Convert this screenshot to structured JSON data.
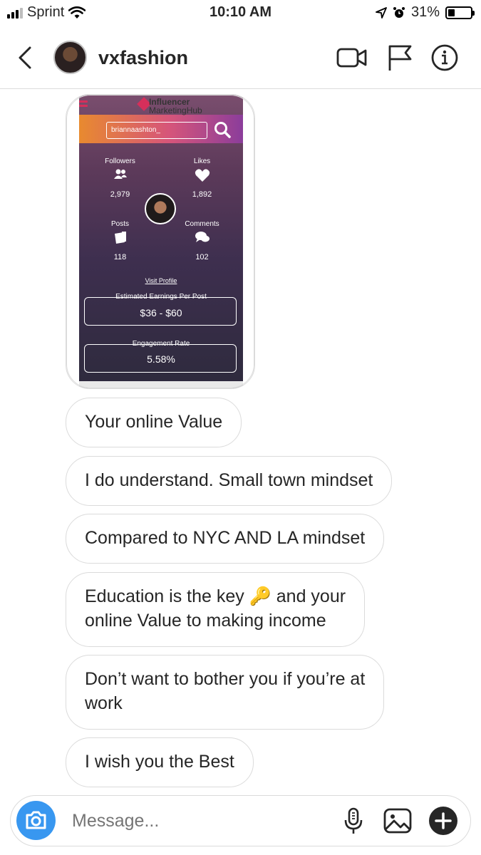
{
  "status_bar": {
    "carrier": "Sprint",
    "time": "10:10 AM",
    "battery_percent": "31%",
    "battery_level": 0.31,
    "signal_bars": 3
  },
  "header": {
    "username": "vxfashion",
    "icons": [
      "back-arrow-icon",
      "video-call-icon",
      "flag-icon",
      "info-icon"
    ]
  },
  "shared_post": {
    "brand_line1": "Influencer",
    "brand_line2": "MarketingHub",
    "search_value": "briannaashton_",
    "stats": [
      {
        "label": "Followers",
        "value": "2,979"
      },
      {
        "label": "Likes",
        "value": "1,892"
      },
      {
        "label": "Posts",
        "value": "118"
      },
      {
        "label": "Comments",
        "value": "102"
      }
    ],
    "visit_profile": "Visit Profile",
    "earnings_label": "Estimated Earnings Per Post",
    "earnings_value": "$36 - $60",
    "engagement_label": "Engagement Rate",
    "engagement_value": "5.58%"
  },
  "messages": [
    {
      "text": "Your online Value"
    },
    {
      "text": "I do understand. Small town mindset"
    },
    {
      "text": "Compared to NYC AND LA mindset"
    },
    {
      "text": "Education is the key 🔑 and your\nonline Value to making income"
    },
    {
      "text": "Don’t want to bother you if you’re at\nwork"
    },
    {
      "text": "I wish you the Best"
    }
  ],
  "composer": {
    "placeholder": "Message...",
    "icons": [
      "camera-icon",
      "microphone-icon",
      "gallery-icon",
      "plus-icon"
    ]
  },
  "colors": {
    "accent_blue": "#3897f0",
    "bubble_border": "#dbdbdb",
    "brand_pink": "#d62f5b"
  }
}
